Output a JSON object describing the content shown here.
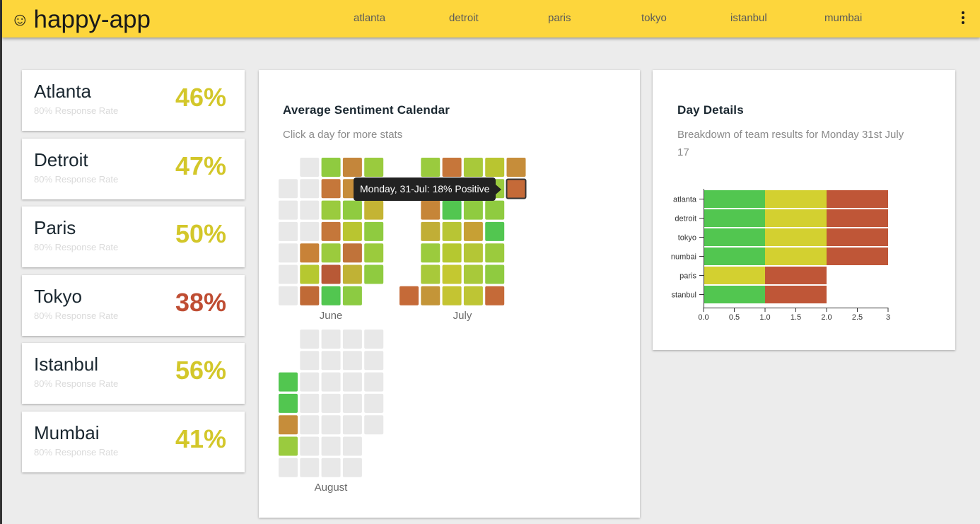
{
  "app": {
    "title": "happy-app",
    "logo_icon": "smiley-icon"
  },
  "nav": [
    "atlanta",
    "detroit",
    "paris",
    "tokyo",
    "istanbul",
    "mumbai"
  ],
  "colors": {
    "accent": "#fdd63c",
    "positive": "#52c650",
    "neutral": "#d3d030",
    "negative": "#bf5637",
    "empty_day": "#e8e8e8"
  },
  "cities": [
    {
      "name": "Atlanta",
      "rate": "80% Response Rate",
      "pct": "46%",
      "pct_color": "#d3c72a"
    },
    {
      "name": "Detroit",
      "rate": "80% Response Rate",
      "pct": "47%",
      "pct_color": "#d3c72a"
    },
    {
      "name": "Paris",
      "rate": "80% Response Rate",
      "pct": "50%",
      "pct_color": "#d3c72a"
    },
    {
      "name": "Tokyo",
      "rate": "80% Response Rate",
      "pct": "38%",
      "pct_color": "#bf4d33"
    },
    {
      "name": "Istanbul",
      "rate": "80% Response Rate",
      "pct": "56%",
      "pct_color": "#d3c72a"
    },
    {
      "name": "Mumbai",
      "rate": "80% Response Rate",
      "pct": "41%",
      "pct_color": "#d3c72a"
    }
  ],
  "calendar": {
    "title": "Average Sentiment Calendar",
    "subtitle": "Click a day for more stats",
    "tooltip": "Monday, 31-Jul: 18% Positive",
    "months": [
      {
        "label": "June",
        "grid": [
          [
            null,
            "#e8e8e8",
            "#e8e8e8",
            "#e8e8e8",
            "#e8e8e8",
            "#e8e8e8",
            "#e8e8e8"
          ],
          [
            "#e8e8e8",
            "#e8e8e8",
            "#e8e8e8",
            "#e8e8e8",
            "#c88238",
            "#b6c830",
            "#c06a36"
          ],
          [
            "#8fcb40",
            "#c5773a",
            "#9acb3e",
            "#c5773a",
            "#9bcb3d",
            "#b85936",
            "#52c650"
          ],
          [
            "#c4863b",
            "#c68d3a",
            "#8fcb40",
            "#b9c530",
            "#c0733a",
            "#c0b235",
            "#8ccb42"
          ],
          [
            "#9acb3e",
            "#9acb3e",
            "#c4b434",
            "#8fcb40",
            "#9bcb3d",
            "#8fcb40",
            null
          ]
        ]
      },
      {
        "label": "July",
        "grid": [
          [
            null,
            null,
            null,
            null,
            null,
            null,
            "#c56a38"
          ],
          [
            "#9acb3e",
            "#9acb3e",
            "#c68538",
            "#c1ae36",
            "#9bcb3d",
            "#a8c93a",
            "#c49538"
          ],
          [
            "#c6763a",
            "#c0b235",
            "#52c650",
            "#b8c534",
            "#b5c830",
            "#c4c830",
            "#c4c432"
          ],
          [
            "#a8c93a",
            "#9bcb3d",
            "#8fcb40",
            "#c7a034",
            "#b4c636",
            "#a8c93a",
            "#bec534"
          ],
          [
            "#b9c530",
            "#9acb3e",
            "#8fcb40",
            "#52c650",
            "#9bcb3d",
            "#8fcb40",
            "#c56a38"
          ],
          [
            "#c68d3a",
            "#c06a36",
            null,
            null,
            null,
            null,
            null
          ]
        ]
      },
      {
        "label": "August",
        "grid": [
          [
            null,
            null,
            "#52c650",
            "#52c650",
            "#c68d3a",
            "#9acb3e",
            "#e8e8e8"
          ],
          [
            "#e8e8e8",
            "#e8e8e8",
            "#e8e8e8",
            "#e8e8e8",
            "#e8e8e8",
            "#e8e8e8",
            "#e8e8e8"
          ],
          [
            "#e8e8e8",
            "#e8e8e8",
            "#e8e8e8",
            "#e8e8e8",
            "#e8e8e8",
            "#e8e8e8",
            "#e8e8e8"
          ],
          [
            "#e8e8e8",
            "#e8e8e8",
            "#e8e8e8",
            "#e8e8e8",
            "#e8e8e8",
            "#e8e8e8",
            "#e8e8e8"
          ],
          [
            "#e8e8e8",
            "#e8e8e8",
            "#e8e8e8",
            "#e8e8e8",
            "#e8e8e8",
            null,
            null
          ]
        ]
      }
    ]
  },
  "day_details": {
    "title": "Day Details",
    "subtitle_line1": "Breakdown of team results for Monday 31st July",
    "subtitle_line2": "17"
  },
  "chart_data": {
    "type": "bar",
    "orientation": "horizontal",
    "stacked": true,
    "categories": [
      "atlanta",
      "detroit",
      "tokyo",
      "mumbai",
      "paris",
      "istanbul"
    ],
    "category_labels_visible": [
      "atlanta",
      "detroit",
      "tokyo",
      "numbai",
      "paris",
      "stanbul"
    ],
    "series": [
      {
        "color": "#52c650",
        "values": [
          1,
          1,
          1,
          1,
          0,
          1
        ]
      },
      {
        "color": "#d3d030",
        "values": [
          1,
          1,
          1,
          1,
          1,
          0
        ]
      },
      {
        "color": "#bf5637",
        "values": [
          1,
          1,
          1,
          1,
          1,
          1
        ]
      }
    ],
    "xlim": [
      0,
      3
    ],
    "xticks": [
      "0.0",
      "0.5",
      "1.0",
      "1.5",
      "2.0",
      "2.5",
      "3"
    ],
    "grid": false,
    "legend": "none"
  }
}
